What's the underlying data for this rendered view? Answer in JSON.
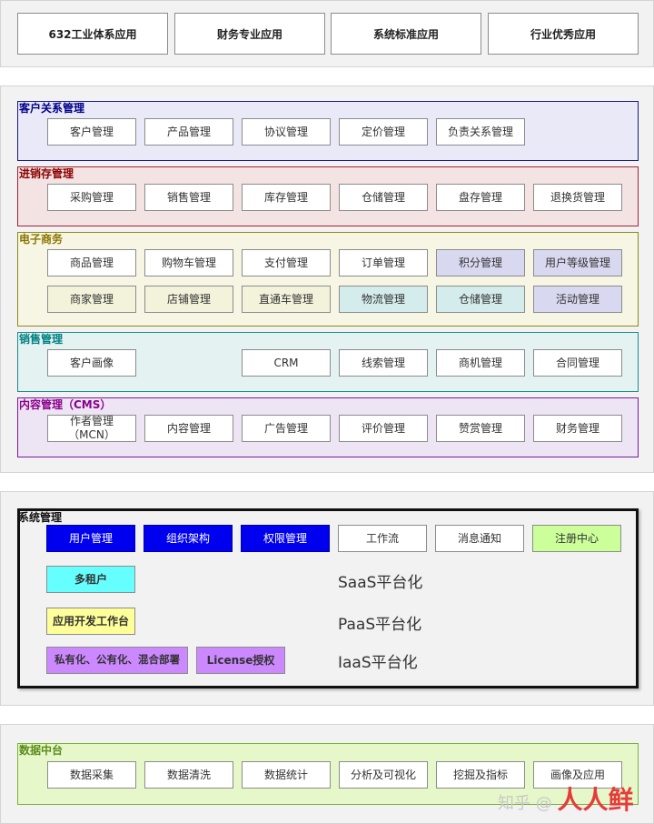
{
  "top_tabs": [
    "632工业体系应用",
    "财务专业应用",
    "系统标准应用",
    "行业优秀应用"
  ],
  "crm": {
    "title": "客户关系管理",
    "items": [
      "客户管理",
      "产品管理",
      "协议管理",
      "定价管理",
      "负责关系管理"
    ]
  },
  "inventory": {
    "title": "进销存管理",
    "items": [
      "采购管理",
      "销售管理",
      "库存管理",
      "仓储管理",
      "盘存管理",
      "退换货管理"
    ]
  },
  "ecommerce": {
    "title": "电子商务",
    "row1": [
      "商品管理",
      "购物车管理",
      "支付管理",
      "订单管理",
      "积分管理",
      "用户等级管理"
    ],
    "row2": [
      "商家管理",
      "店铺管理",
      "直通车管理",
      "物流管理",
      "仓储管理",
      "活动管理"
    ]
  },
  "sales": {
    "title": "销售管理",
    "items": [
      "客户画像",
      "CRM",
      "线索管理",
      "商机管理",
      "合同管理"
    ]
  },
  "cms": {
    "title": "内容管理（CMS）",
    "items": [
      "作者管理\n（MCN）",
      "内容管理",
      "广告管理",
      "评价管理",
      "赞赏管理",
      "财务管理"
    ]
  },
  "system": {
    "title": "系统管理",
    "items": [
      "用户管理",
      "组织架构",
      "权限管理",
      "工作流",
      "消息通知",
      "注册中心"
    ],
    "multi_tenant": "多租户",
    "dev_platform": "应用开发工作台",
    "deploy": "私有化、公有化、混合部署",
    "license": "License授权",
    "saas": "SaaS平台化",
    "paas": "PaaS平台化",
    "iaas": "IaaS平台化"
  },
  "data_center": {
    "title": "数据中台",
    "items": [
      "数据采集",
      "数据清洗",
      "数据统计",
      "分析及可视化",
      "挖掘及指标",
      "画像及应用"
    ]
  },
  "watermark": {
    "text": "知乎 @",
    "logo": "人人鲜"
  },
  "colors": {
    "crm_bg": "#e9e9f7",
    "crm_border": "#1a1a8c",
    "crm_title": "#00008b",
    "inv_bg": "#f4e3e3",
    "inv_border": "#a0243a",
    "inv_title": "#8b0000",
    "ec_bg": "#f7f5e3",
    "ec_border": "#8c8a1a",
    "ec_title": "#8b7500",
    "sales_bg": "#e4f2f2",
    "sales_border": "#1a8c8c",
    "sales_title": "#008080",
    "cms_bg": "#ede4f4",
    "cms_border": "#7a1aa0",
    "cms_title": "#8b008b",
    "blue_btn": "#0000ee",
    "green_btn": "#ccff99",
    "cyan_btn": "#66ffff",
    "yellow_btn": "#ffff99",
    "purple_btn": "#cc88ff",
    "data_bg": "#e6f7c9",
    "data_border": "#7ab33a",
    "data_title": "#5a8c1a"
  }
}
